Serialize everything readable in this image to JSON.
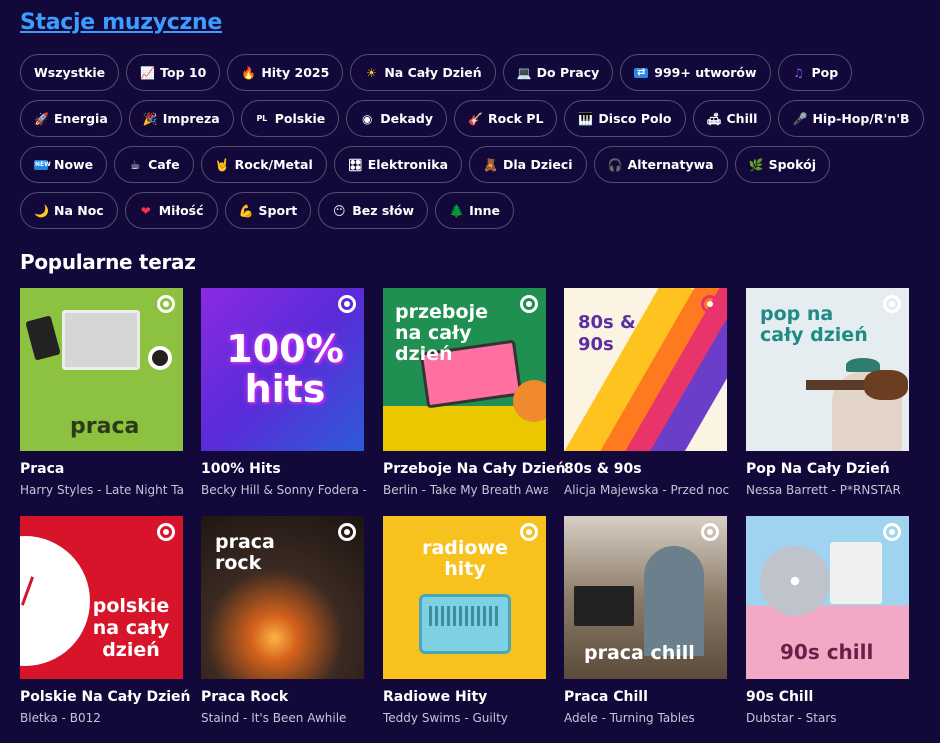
{
  "page_title": "Stacje muzyczne",
  "section_title": "Popularne teraz",
  "chips": [
    {
      "icon": "",
      "label": "Wszystkie",
      "icon_name": "none"
    },
    {
      "icon": "📈",
      "label": "Top 10",
      "icon_name": "chart-up-icon"
    },
    {
      "icon": "🔥",
      "label": "Hity 2025",
      "icon_name": "fire-icon"
    },
    {
      "icon": "☀",
      "label": "Na Cały Dzień",
      "icon_name": "sun-icon"
    },
    {
      "icon": "💻",
      "label": "Do Pracy",
      "icon_name": "laptop-icon"
    },
    {
      "icon": "⇄",
      "label": "999+ utworów",
      "icon_name": "shuffle-icon"
    },
    {
      "icon": "♫",
      "label": "Pop",
      "icon_name": "music-notes-icon"
    },
    {
      "icon": "🚀",
      "label": "Energia",
      "icon_name": "rocket-icon"
    },
    {
      "icon": "🎉",
      "label": "Impreza",
      "icon_name": "party-popper-icon"
    },
    {
      "icon": "PL",
      "label": "Polskie",
      "icon_name": "pl-flag-icon"
    },
    {
      "icon": "◉",
      "label": "Dekady",
      "icon_name": "vinyl-disc-icon"
    },
    {
      "icon": "🎸",
      "label": "Rock PL",
      "icon_name": "guitar-icon"
    },
    {
      "icon": "🎹",
      "label": "Disco Polo",
      "icon_name": "piano-icon"
    },
    {
      "icon": "🛋",
      "label": "Chill",
      "icon_name": "couch-icon"
    },
    {
      "icon": "🎤",
      "label": "Hip-Hop/R'n'B",
      "icon_name": "microphone-icon"
    },
    {
      "icon": "NEW",
      "label": "Nowe",
      "icon_name": "new-badge-icon"
    },
    {
      "icon": "☕",
      "label": "Cafe",
      "icon_name": "coffee-icon"
    },
    {
      "icon": "🤘",
      "label": "Rock/Metal",
      "icon_name": "rock-hand-icon"
    },
    {
      "icon": "🎛",
      "label": "Elektronika",
      "icon_name": "control-knobs-icon"
    },
    {
      "icon": "🧸",
      "label": "Dla Dzieci",
      "icon_name": "teddy-bear-icon"
    },
    {
      "icon": "🎧",
      "label": "Alternatywa",
      "icon_name": "headphones-icon"
    },
    {
      "icon": "🌿",
      "label": "Spokój",
      "icon_name": "herb-icon"
    },
    {
      "icon": "🌙",
      "label": "Na Noc",
      "icon_name": "moon-icon"
    },
    {
      "icon": "❤",
      "label": "Miłość",
      "icon_name": "heart-icon"
    },
    {
      "icon": "💪",
      "label": "Sport",
      "icon_name": "flexed-biceps-icon"
    },
    {
      "icon": "😶",
      "label": "Bez słów",
      "icon_name": "no-mouth-face-icon"
    },
    {
      "icon": "🌲",
      "label": "Inne",
      "icon_name": "tree-icon"
    }
  ],
  "stations": [
    {
      "title": "Praca",
      "subtitle": "Harry Styles - Late Night Talking",
      "cover_text": "praca",
      "cover_bg": "#8dc241"
    },
    {
      "title": "100% Hits",
      "subtitle": "Becky Hill & Sonny Fodera - Never Be Alone",
      "cover_text": "100% hits",
      "cover_bg": "#6a2ce0"
    },
    {
      "title": "Przeboje Na Cały Dzień",
      "subtitle": "Berlin - Take My Breath Away",
      "cover_text": "przeboje na cały dzień",
      "cover_bg": "#1f8f52"
    },
    {
      "title": "80s & 90s",
      "subtitle": "Alicja Majewska - Przed nocą",
      "cover_text": "80s & 90s",
      "cover_bg": "#fbf4e2"
    },
    {
      "title": "Pop Na Cały Dzień",
      "subtitle": "Nessa Barrett - P*RNSTAR",
      "cover_text": "pop na cały dzień",
      "cover_bg": "#e6edf0"
    },
    {
      "title": "Polskie Na Cały Dzień",
      "subtitle": "Bletka - B012",
      "cover_text": "polskie na cały dzień",
      "cover_bg": "#d7142a"
    },
    {
      "title": "Praca Rock",
      "subtitle": "Staind - It's Been Awhile",
      "cover_text": "praca rock",
      "cover_bg": "#3b2a22"
    },
    {
      "title": "Radiowe Hity",
      "subtitle": "Teddy Swims - Guilty",
      "cover_text": "radiowe hity",
      "cover_bg": "#f7c21e"
    },
    {
      "title": "Praca Chill",
      "subtitle": "Adele - Turning Tables",
      "cover_text": "praca chill",
      "cover_bg": "#7a6a5a"
    },
    {
      "title": "90s Chill",
      "subtitle": "Dubstar - Stars",
      "cover_text": "90s chill",
      "cover_bg": "#9fd3ef"
    }
  ]
}
